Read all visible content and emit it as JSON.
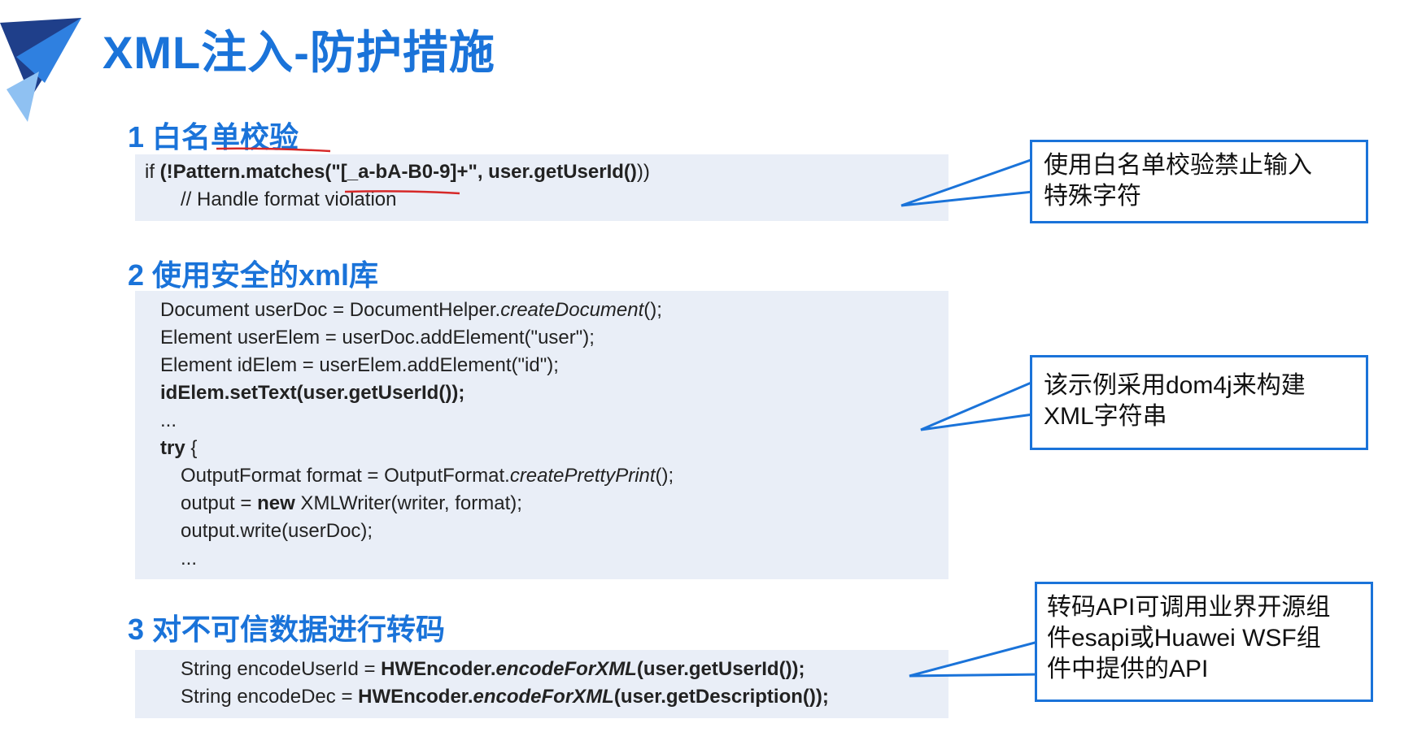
{
  "title": "XML注入-防护措施",
  "sections": [
    {
      "heading": "1 白名单校验",
      "code": [
        {
          "parts": [
            {
              "text": "if ",
              "style": ""
            },
            {
              "text": "(!Pattern.matches(\"[_a-bA-B0-9]+\", user.getUserId()",
              "style": "b"
            },
            {
              "text": "))",
              "style": ""
            }
          ]
        },
        {
          "parts": [
            {
              "text": "// Handle format violation",
              "style": ""
            }
          ]
        }
      ],
      "callout": [
        "使用白名单校验禁止输入",
        "特殊字符"
      ]
    },
    {
      "heading": "2 使用安全的xml库",
      "code": [
        {
          "parts": [
            {
              "text": "Document userDoc = DocumentHelper.",
              "style": ""
            },
            {
              "text": "createDocument",
              "style": "i"
            },
            {
              "text": "();",
              "style": ""
            }
          ]
        },
        {
          "parts": [
            {
              "text": "Element userElem = userDoc.addElement(\"user\");",
              "style": ""
            }
          ]
        },
        {
          "parts": [
            {
              "text": "Element idElem = userElem.addElement(\"id\");",
              "style": ""
            }
          ]
        },
        {
          "parts": [
            {
              "text": "idElem.setText(user.getUserId());",
              "style": "b"
            }
          ]
        },
        {
          "parts": [
            {
              "text": "...",
              "style": ""
            }
          ]
        },
        {
          "parts": [
            {
              "text": "try",
              "style": "b"
            },
            {
              "text": " {",
              "style": ""
            }
          ]
        },
        {
          "parts": [
            {
              "text": "OutputFormat format = OutputFormat.",
              "style": ""
            },
            {
              "text": "createPrettyPrint",
              "style": "i"
            },
            {
              "text": "();",
              "style": ""
            }
          ]
        },
        {
          "parts": [
            {
              "text": "output = ",
              "style": ""
            },
            {
              "text": "new",
              "style": "b"
            },
            {
              "text": " XMLWriter(writer, format);",
              "style": ""
            }
          ]
        },
        {
          "parts": [
            {
              "text": "output.write(userDoc);",
              "style": ""
            }
          ]
        },
        {
          "parts": [
            {
              "text": "...",
              "style": ""
            }
          ]
        }
      ],
      "callout": [
        "该示例采用dom4j来构建",
        "XML字符串"
      ]
    },
    {
      "heading": "3 对不可信数据进行转码",
      "code": [
        {
          "parts": [
            {
              "text": "String encodeUserId = ",
              "style": ""
            },
            {
              "text": "HWEncoder.",
              "style": "b"
            },
            {
              "text": "encodeForXML",
              "style": "b i"
            },
            {
              "text": "(user.getUserId());",
              "style": "b"
            }
          ]
        },
        {
          "parts": [
            {
              "text": "String encodeDec = ",
              "style": ""
            },
            {
              "text": "HWEncoder.",
              "style": "b"
            },
            {
              "text": "encodeForXML",
              "style": "b i"
            },
            {
              "text": "(user.getDescription());",
              "style": "b"
            }
          ]
        }
      ],
      "callout": [
        "转码API可调用业界开源组",
        "件esapi或Huawei WSF组",
        "件中提供的API"
      ]
    }
  ],
  "colors": {
    "accent": "#1a73d9",
    "codebg": "#e9eef7",
    "underline": "#d62828"
  }
}
